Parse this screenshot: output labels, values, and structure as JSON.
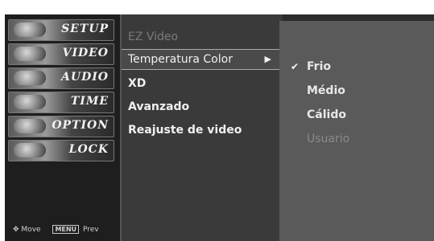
{
  "sidebar": {
    "tabs": [
      {
        "label": "SETUP"
      },
      {
        "label": "VIDEO"
      },
      {
        "label": "AUDIO"
      },
      {
        "label": "TIME"
      },
      {
        "label": "OPTION"
      },
      {
        "label": "LOCK"
      }
    ],
    "footer": {
      "move_label": "Move",
      "menu_key": "MENU",
      "prev_label": "Prev"
    }
  },
  "menu": {
    "items": [
      {
        "label": "EZ Video"
      },
      {
        "label": "Temperatura Color"
      },
      {
        "label": "XD"
      },
      {
        "label": "Avanzado"
      },
      {
        "label": "Reajuste de video"
      }
    ],
    "selected_arrow": "▶"
  },
  "submenu": {
    "options": [
      {
        "label": "Frio"
      },
      {
        "label": "Médio"
      },
      {
        "label": "Cálido"
      },
      {
        "label": "Usuario"
      }
    ],
    "check_glyph": "✔"
  },
  "colors": {
    "background": "#2b2b2b",
    "sidebar": "#1e1e1e",
    "menu_panel": "#3a3a3a",
    "submenu_panel": "#5a5a5a",
    "text": "#f0f0f0",
    "dim_text": "#7a7a7a"
  }
}
